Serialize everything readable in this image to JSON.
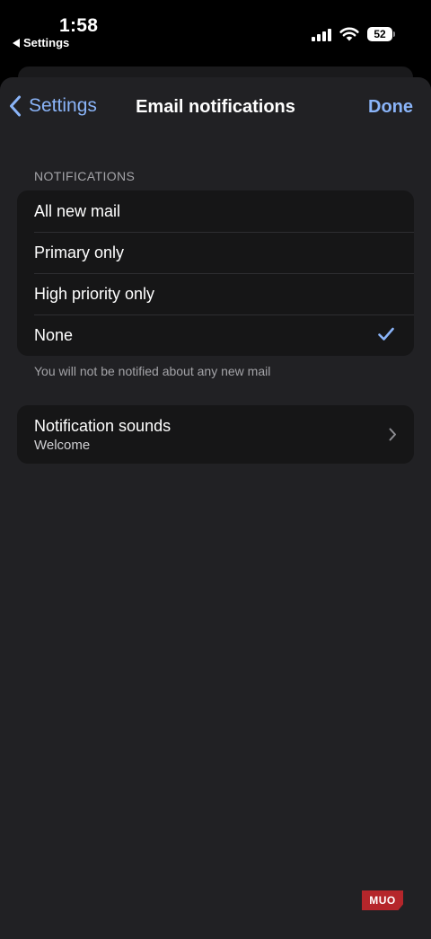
{
  "status_bar": {
    "time": "1:58",
    "back_label": "Settings",
    "battery": "52"
  },
  "nav": {
    "back_label": "Settings",
    "title": "Email notifications",
    "done_label": "Done"
  },
  "notifications": {
    "header": "NOTIFICATIONS",
    "options": [
      {
        "label": "All new mail",
        "selected": false
      },
      {
        "label": "Primary only",
        "selected": false
      },
      {
        "label": "High priority only",
        "selected": false
      },
      {
        "label": "None",
        "selected": true
      }
    ],
    "footer": "You will not be notified about any new mail"
  },
  "sounds": {
    "title": "Notification sounds",
    "value": "Welcome"
  },
  "watermark": "MUO",
  "colors": {
    "accent": "#8ab4f8",
    "background": "#212124",
    "group_background": "#161617"
  }
}
